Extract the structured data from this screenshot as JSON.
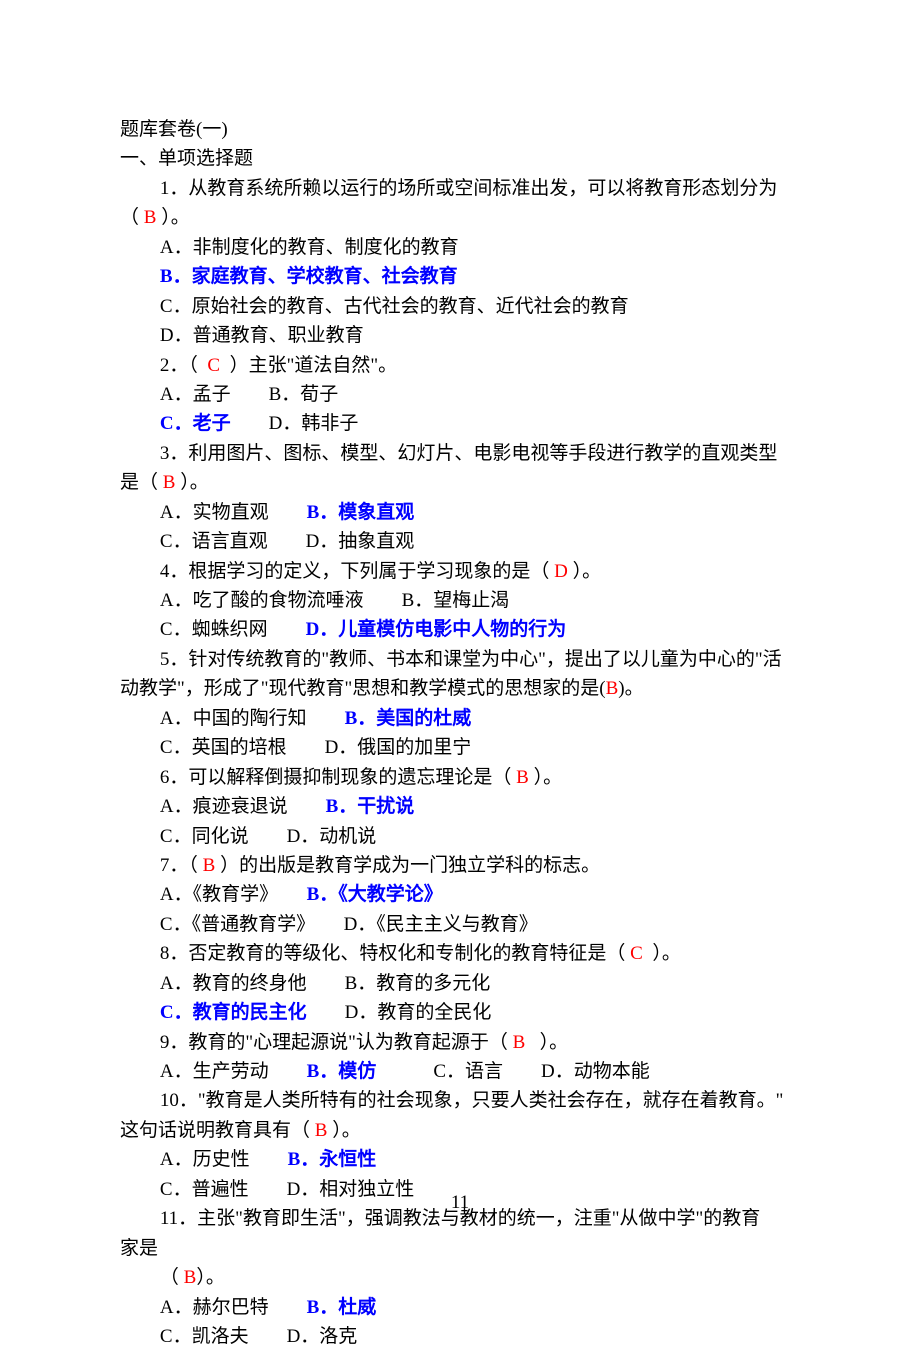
{
  "header": "题库套卷(一)",
  "sectionTitle": "一、单项选择题",
  "q1": {
    "stemPart1": "1．从教育系统所赖以运行的场所或空间标准出发，可以将教育形态划分为",
    "stemOpen": "（ ",
    "ansLetter": "B",
    "stemClose": " ）。",
    "optA": "A．非制度化的教育、制度化的教育",
    "optB": "B．家庭教育、学校教育、社会教育",
    "optC": "C．原始社会的教育、古代社会的教育、近代社会的教育",
    "optD": "D．普通教育、职业教育"
  },
  "q2": {
    "stemA": "2．（  ",
    "ansLetter": "C",
    "stemB": "  ）主张\"道法自然\"。",
    "lineAB": "A．孟子　　B．荀子",
    "optC": "C．老子",
    "optD": "　　D．韩非子"
  },
  "q3": {
    "stemA": "3．利用图片、图标、模型、幻灯片、电影电视等手段进行教学的直观类型",
    "stemB_a": "是（ ",
    "ansLetter": "B",
    "stemB_b": " ）。",
    "optA": "A．实物直观　　",
    "optB": "B．模象直观",
    "lineCD": "C．语言直观　　D．抽象直观"
  },
  "q4": {
    "stemA": "4．根据学习的定义，下列属于学习现象的是（ ",
    "ansLetter": "D",
    "stemB": " ）。",
    "lineAB": "A．吃了酸的食物流唾液　　B．望梅止渴",
    "optC": "C．蜘蛛织网　　",
    "optD": "D．儿童模仿电影中人物的行为"
  },
  "q5": {
    "line1": "5．针对传统教育的\"教师、书本和课堂为中心\"，提出了以儿童为中心的\"活",
    "line2a": "动教学\"，形成了\"现代教育\"思想和教学模式的思想家的是(",
    "ans": "B",
    "line2b": ")。",
    "optA": "A．中国的陶行知　　",
    "optB": "B．美国的杜威",
    "lineCD": "C．英国的培根　　D．俄国的加里宁"
  },
  "q6": {
    "stemA": "6．可以解释倒摄抑制现象的遗忘理论是（ ",
    "ans": "B",
    "stemB": " ）。",
    "optA": "A．痕迹衰退说　　",
    "optB": "B．干扰说",
    "lineCD": "C．同化说　　D．动机说"
  },
  "q7": {
    "stemA": "7．（ ",
    "ans": "B",
    "stemB": " ）的出版是教育学成为一门独立学科的标志。",
    "optA": "A．《教育学》　　",
    "optB": "B．《大教学论》",
    "lineCD": "C．《普通教育学》　　D．《民主主义与教育》"
  },
  "q8": {
    "stemA": "8．否定教育的等级化、特权化和专制化的教育特征是（ ",
    "ans": "C",
    "stemB": "  ）。",
    "lineAB": "A．教育的终身他　　B．教育的多元化",
    "optC": "C．教育的民主化",
    "optD": "　　D．教育的全民化"
  },
  "q9": {
    "stemA": "9．教育的\"心理起源说\"认为教育起源于（ ",
    "ans": "B",
    "stemB": "   ）。",
    "optA": "A．生产劳动　　",
    "optB": "B．模仿",
    "optCD": "　　　C．语言　　D．动物本能"
  },
  "q10": {
    "line1": "10．\"教育是人类所特有的社会现象，只要人类社会存在，就存在着教育。\"",
    "line2a": "这句话说明教育具有（ ",
    "ans": "B",
    "line2b": " ）。",
    "optA": "A．历史性　　",
    "optB": "B．永恒性",
    "lineCD": "C．普遍性　　D．相对独立性"
  },
  "q11": {
    "line1": "11．主张\"教育即生活\"，强调教法与教材的统一，注重\"从做中学\"的教育",
    "line2": "家是",
    "line3a": "（ ",
    "ans": "B",
    "line3b": "）。",
    "optA": "A．赫尔巴特　　",
    "optB": "B．杜威",
    "lineCD": "C．凯洛夫　　D．洛克"
  },
  "pageNumber": "11"
}
